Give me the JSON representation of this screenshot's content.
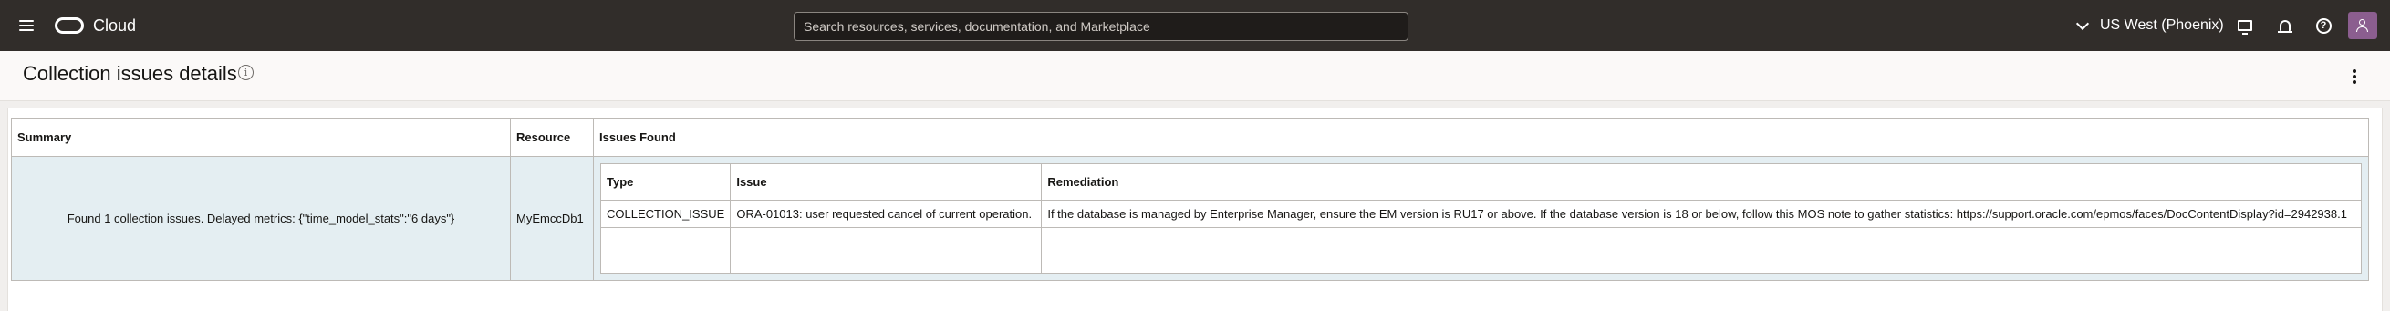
{
  "topbar": {
    "brand": "Cloud",
    "search_placeholder": "Search resources, services, documentation, and Marketplace",
    "region": "US West (Phoenix)",
    "icons": [
      "menu-icon",
      "oracle-logo-icon",
      "chevron-down-icon",
      "monitor-icon",
      "bell-icon",
      "help-icon",
      "user-icon"
    ]
  },
  "page": {
    "title": "Collection issues details",
    "info_glyph": "i"
  },
  "table": {
    "columns": [
      "Summary",
      "Resource",
      "Issues Found"
    ],
    "rows": [
      {
        "summary": "Found 1 collection issues. Delayed metrics: {\"time_model_stats\":\"6 days\"}",
        "resource": "MyEmccDb1",
        "issues": {
          "columns": [
            "Type",
            "Issue",
            "Remediation"
          ],
          "rows": [
            {
              "type": "COLLECTION_ISSUE",
              "issue": "ORA-01013: user requested cancel of current operation.",
              "remediation": "If the database is managed by Enterprise Manager, ensure the EM version is RU17 or above. If the database version is 18 or below, follow this MOS note to gather statistics: https://support.oracle.com/epmos/faces/DocContentDisplay?id=2942938.1"
            }
          ]
        }
      }
    ]
  }
}
